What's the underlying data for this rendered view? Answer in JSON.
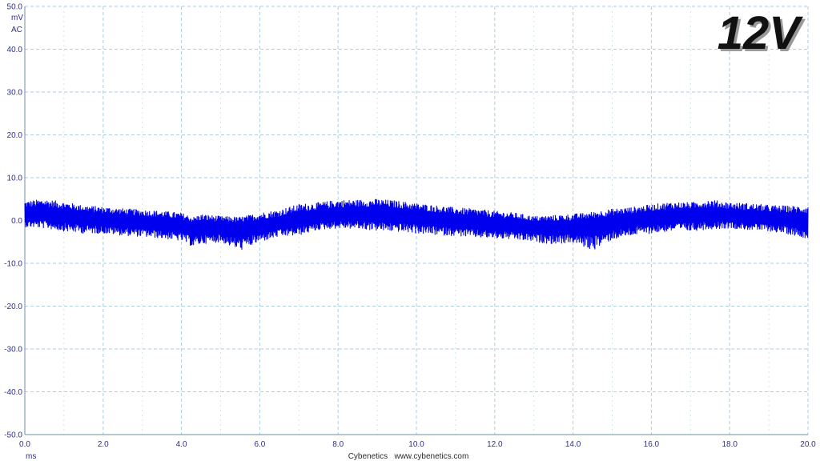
{
  "chart_data": {
    "type": "line",
    "title": "12V",
    "xlabel": "ms",
    "ylabel": "mV",
    "coupling": "AC",
    "footer": "Cybenetics   www.cybenetics.com",
    "xlim": [
      0.0,
      20.0
    ],
    "ylim": [
      -50.0,
      50.0
    ],
    "x_ticks": [
      "0.0",
      "2.0",
      "4.0",
      "6.0",
      "8.0",
      "10.0",
      "12.0",
      "14.0",
      "16.0",
      "18.0",
      "20.0"
    ],
    "y_ticks": [
      "50.0",
      "40.0",
      "30.0",
      "20.0",
      "10.0",
      "0.0",
      "-10.0",
      "-20.0",
      "-30.0",
      "-40.0",
      "-50.0"
    ],
    "grid": true,
    "grid_minor_x": true,
    "series": [
      {
        "color": "#0000ee",
        "x": [
          0.0,
          0.5,
          1.0,
          1.5,
          2.0,
          2.5,
          3.0,
          3.5,
          4.0,
          4.3,
          4.5,
          5.0,
          5.5,
          6.0,
          6.5,
          7.0,
          7.5,
          8.0,
          8.5,
          9.0,
          9.5,
          10.0,
          10.5,
          11.0,
          11.5,
          12.0,
          12.5,
          13.0,
          13.5,
          14.0,
          14.5,
          15.0,
          15.5,
          16.0,
          16.5,
          17.0,
          17.5,
          18.0,
          18.5,
          19.0,
          19.5,
          20.0
        ],
        "center": [
          1.5,
          1.6,
          1.2,
          0.8,
          0.3,
          0.0,
          -0.3,
          -0.7,
          -1.2,
          -1.7,
          -1.5,
          -1.6,
          -1.8,
          -1.3,
          -0.5,
          0.3,
          0.9,
          1.4,
          1.6,
          1.5,
          1.3,
          0.8,
          0.4,
          0.0,
          -0.4,
          -0.8,
          -1.0,
          -1.4,
          -1.6,
          -1.4,
          -0.9,
          -0.3,
          0.3,
          0.8,
          1.1,
          1.3,
          1.4,
          1.2,
          0.8,
          0.5,
          0.3,
          0.0
        ],
        "envelope_upper": [
          4.5,
          5.0,
          4.3,
          3.5,
          3.2,
          2.8,
          2.5,
          2.2,
          1.8,
          0.8,
          1.5,
          1.0,
          0.8,
          1.8,
          2.5,
          3.8,
          4.2,
          4.8,
          4.8,
          5.0,
          4.6,
          4.0,
          3.5,
          3.0,
          2.7,
          2.2,
          1.8,
          1.0,
          1.2,
          1.5,
          2.0,
          2.7,
          3.1,
          3.7,
          4.3,
          4.2,
          4.9,
          4.2,
          4.0,
          3.6,
          3.4,
          3.4
        ],
        "envelope_lower": [
          -1.5,
          -1.8,
          -2.5,
          -3.0,
          -3.0,
          -3.5,
          -3.8,
          -4.2,
          -4.8,
          -6.2,
          -5.5,
          -5.0,
          -7.0,
          -5.0,
          -3.8,
          -3.5,
          -2.2,
          -1.8,
          -2.0,
          -2.4,
          -2.6,
          -3.0,
          -3.4,
          -3.6,
          -4.0,
          -4.2,
          -4.5,
          -5.0,
          -5.5,
          -5.2,
          -7.0,
          -4.5,
          -3.5,
          -3.0,
          -2.5,
          -2.5,
          -2.0,
          -1.8,
          -2.2,
          -2.5,
          -3.2,
          -4.2
        ]
      }
    ]
  }
}
